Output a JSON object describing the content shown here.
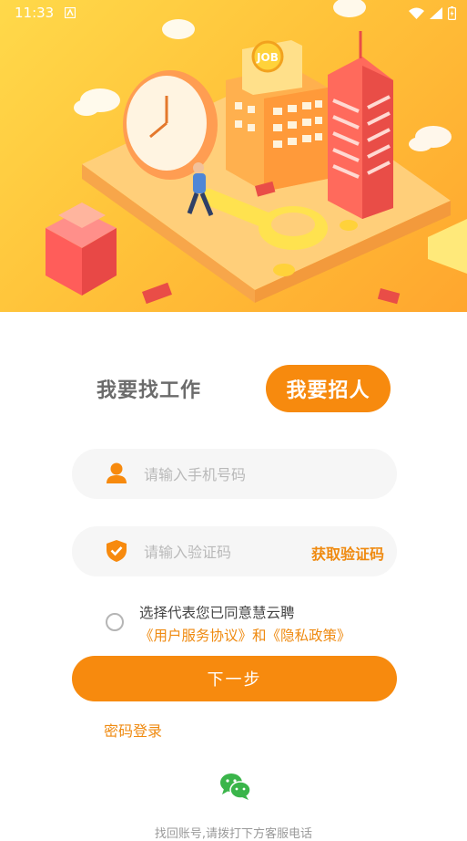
{
  "status_bar": {
    "time": "11:33"
  },
  "tabs": {
    "find_job": "我要找工作",
    "recruit": "我要招人"
  },
  "phone_field": {
    "placeholder": "请输入手机号码"
  },
  "code_field": {
    "placeholder": "请输入验证码",
    "get_code": "获取验证码"
  },
  "agreement": {
    "prefix": "选择代表您已同意慧云聘",
    "user_agreement": "《用户服务协议》",
    "and": "和",
    "privacy_policy": "《隐私政策》"
  },
  "next_button": "下一步",
  "password_login": "密码登录",
  "bottom_hint": "找回账号,请拨打下方客服电话",
  "banner": {
    "sign_text": "JOB"
  },
  "colors": {
    "accent": "#f78a0e",
    "field_bg": "#f6f6f6",
    "banner_top": "#ffd94a",
    "banner_bottom": "#ffa62e"
  }
}
